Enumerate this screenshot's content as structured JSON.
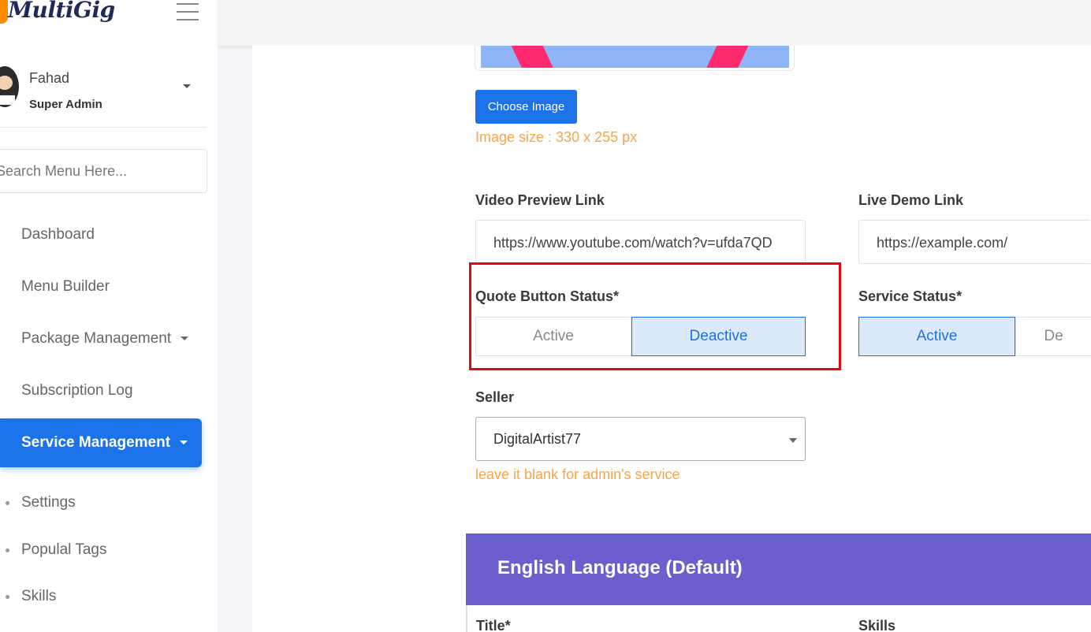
{
  "app": {
    "logo_text": "MultiGig"
  },
  "user": {
    "name": "Fahad",
    "role": "Super Admin"
  },
  "sidebar": {
    "search_placeholder": "Search Menu Here...",
    "items": [
      {
        "label": "Dashboard"
      },
      {
        "label": "Menu Builder"
      },
      {
        "label": "Package Management",
        "has_caret": true
      },
      {
        "label": "Subscription Log"
      },
      {
        "label": "Service Management",
        "has_caret": true,
        "active": true
      }
    ],
    "sub_items": [
      {
        "label": "Settings"
      },
      {
        "label": "Populal Tags"
      },
      {
        "label": "Skills"
      }
    ]
  },
  "form": {
    "choose_image_label": "Choose Image",
    "image_size_hint": "Image size : 330 x 255 px",
    "video_preview": {
      "label": "Video Preview Link",
      "value": "https://www.youtube.com/watch?v=ufda7QD"
    },
    "live_demo": {
      "label": "Live Demo Link",
      "value": "https://example.com/"
    },
    "quote_button_status": {
      "label": "Quote Button Status*",
      "options": [
        "Active",
        "Deactive"
      ],
      "selected": "Deactive"
    },
    "service_status": {
      "label": "Service Status*",
      "options": [
        "Active",
        "De"
      ],
      "selected": "Active"
    },
    "seller": {
      "label": "Seller",
      "value": "DigitalArtist77",
      "hint": "leave it blank for admin's service"
    },
    "language_section": {
      "title": "English Language (Default)"
    },
    "title_label": "Title*",
    "skills_label": "Skills"
  },
  "colors": {
    "primary": "#1c72e8",
    "accent_hint": "#f5a54a",
    "language_header": "#6a5fcd",
    "highlight": "#e0090f"
  }
}
